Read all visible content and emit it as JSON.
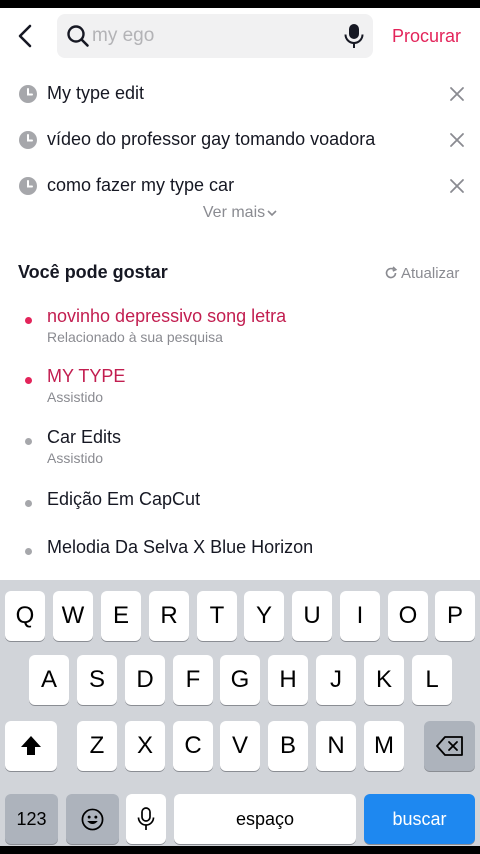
{
  "search": {
    "placeholder": "my ego",
    "submit_label": "Procurar"
  },
  "history": [
    {
      "text": "My type edit"
    },
    {
      "text": "vídeo do professor gay tomando voadora"
    },
    {
      "text": "como fazer my type car"
    }
  ],
  "see_more_label": "Ver mais",
  "suggestions": {
    "title": "Você pode gostar",
    "refresh_label": "Atualizar",
    "items": [
      {
        "title": "novinho depressivo song letra",
        "subtitle": "Relacionado à sua pesquisa",
        "highlighted": true
      },
      {
        "title": "MY TYPE",
        "subtitle": "Assistido",
        "highlighted": true
      },
      {
        "title": "Car Edits",
        "subtitle": "Assistido",
        "highlighted": false
      },
      {
        "title": "Edição Em CapCut",
        "subtitle": "",
        "highlighted": false
      },
      {
        "title": "Melodia Da Selva X Blue Horizon",
        "subtitle": "",
        "highlighted": false
      }
    ]
  },
  "keyboard": {
    "row1": [
      "Q",
      "W",
      "E",
      "R",
      "T",
      "Y",
      "U",
      "I",
      "O",
      "P"
    ],
    "row2": [
      "A",
      "S",
      "D",
      "F",
      "G",
      "H",
      "J",
      "K",
      "L"
    ],
    "row3": [
      "Z",
      "X",
      "C",
      "V",
      "B",
      "N",
      "M"
    ],
    "numbers_label": "123",
    "space_label": "espaço",
    "return_label": "buscar"
  },
  "colors": {
    "accent": "#e3245a",
    "highlight_text": "#c21e50",
    "return_key": "#1e88f0"
  },
  "icons": [
    "back-icon",
    "search-icon",
    "microphone-icon",
    "clock-icon",
    "close-icon",
    "chevron-down-icon",
    "refresh-icon",
    "shift-icon",
    "emoji-icon",
    "backspace-icon"
  ]
}
